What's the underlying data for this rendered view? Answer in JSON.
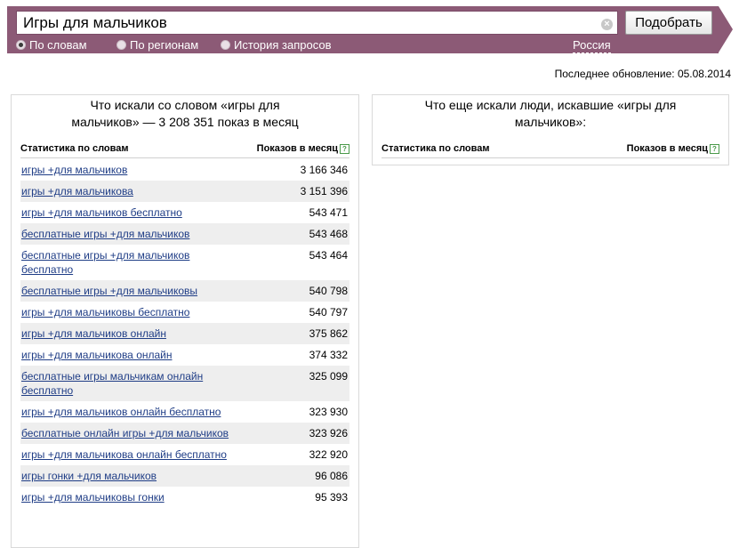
{
  "search": {
    "value": "Игры для мальчиков",
    "submit_label": "Подобрать",
    "clear_glyph": "×"
  },
  "modes": [
    {
      "label": "По словам",
      "selected": true
    },
    {
      "label": "По регионам",
      "selected": false
    },
    {
      "label": "История запросов",
      "selected": false
    }
  ],
  "region": "Россия",
  "last_update": "Последнее обновление: 05.08.2014",
  "left_panel": {
    "title_line1": "Что искали со словом «игры для",
    "title_line2": "мальчиков» — 3 208 351 показ в месяц",
    "col_phrase": "Статистика по словам",
    "col_count": "Показов в месяц",
    "help_glyph": "?",
    "rows": [
      {
        "phrase": "игры +для мальчиков",
        "count": "3 166 346"
      },
      {
        "phrase": "игры +для мальчикова",
        "count": "3 151 396"
      },
      {
        "phrase": "игры +для мальчиков бесплатно",
        "count": "543 471"
      },
      {
        "phrase": "бесплатные игры +для мальчиков",
        "count": "543 468"
      },
      {
        "phrase": "бесплатные игры +для мальчиков бесплатно",
        "count": "543 464"
      },
      {
        "phrase": "бесплатные игры +для мальчиковы",
        "count": "540 798"
      },
      {
        "phrase": "игры +для мальчиковы бесплатно",
        "count": "540 797"
      },
      {
        "phrase": "игры +для мальчиков онлайн",
        "count": "375 862"
      },
      {
        "phrase": "игры +для мальчикова онлайн",
        "count": "374 332"
      },
      {
        "phrase": "бесплатные игры мальчикам онлайн бесплатно",
        "count": "325 099"
      },
      {
        "phrase": "игры +для мальчиков онлайн бесплатно",
        "count": "323 930"
      },
      {
        "phrase": "бесплатные онлайн игры +для мальчиков",
        "count": "323 926"
      },
      {
        "phrase": "игры +для мальчикова онлайн бесплатно",
        "count": "322 920"
      },
      {
        "phrase": "игры гонки +для мальчиков",
        "count": "96 086"
      },
      {
        "phrase": "игры +для мальчиковы гонки",
        "count": "95 393"
      }
    ]
  },
  "right_panel": {
    "title_line1": "Что еще искали люди, искавшие «игры для",
    "title_line2": "мальчиков»:",
    "col_phrase": "Статистика по словам",
    "col_count": "Показов в месяц",
    "help_glyph": "?"
  },
  "colors": {
    "bar": "#8c5a76",
    "link": "#1f3d86",
    "row_alt": "#eeeeee"
  }
}
